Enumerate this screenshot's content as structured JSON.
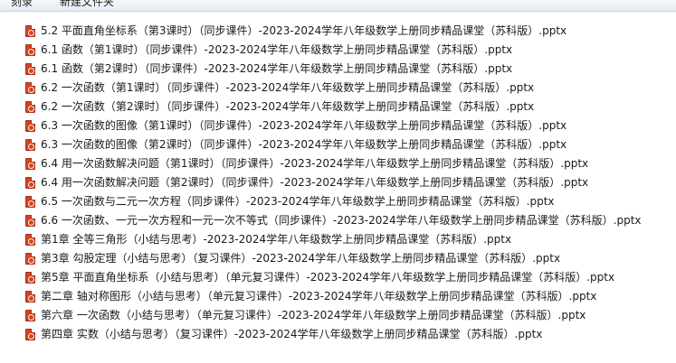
{
  "toolbar": {
    "burn_label": "刻录",
    "new_folder_label": "新建文件夹"
  },
  "files": [
    {
      "name": "5.2 平面直角坐标系（第3课时）（同步课件）-2023-2024学年八年级数学上册同步精品课堂（苏科版）.pptx",
      "icon": "pptx-file-icon"
    },
    {
      "name": "6.1 函数（第1课时）（同步课件）-2023-2024学年八年级数学上册同步精品课堂（苏科版）.pptx",
      "icon": "pptx-file-icon"
    },
    {
      "name": "6.1 函数（第2课时）（同步课件）-2023-2024学年八年级数学上册同步精品课堂（苏科版）.pptx",
      "icon": "pptx-file-icon"
    },
    {
      "name": "6.2 一次函数（第1课时）（同步课件）-2023-2024学年八年级数学上册同步精品课堂（苏科版）.pptx",
      "icon": "pptx-file-icon"
    },
    {
      "name": "6.2 一次函数（第2课时）（同步课件）-2023-2024学年八年级数学上册同步精品课堂（苏科版）.pptx",
      "icon": "pptx-file-icon"
    },
    {
      "name": "6.3 一次函数的图像（第1课时）（同步课件）-2023-2024学年八年级数学上册同步精品课堂（苏科版）.pptx",
      "icon": "pptx-file-icon"
    },
    {
      "name": "6.3 一次函数的图像（第2课时）（同步课件）-2023-2024学年八年级数学上册同步精品课堂（苏科版）.pptx",
      "icon": "pptx-file-icon"
    },
    {
      "name": "6.4 用一次函数解决问题（第1课时）（同步课件）-2023-2024学年八年级数学上册同步精品课堂（苏科版）.pptx",
      "icon": "pptx-file-icon"
    },
    {
      "name": "6.4 用一次函数解决问题（第2课时）（同步课件）-2023-2024学年八年级数学上册同步精品课堂（苏科版）.pptx",
      "icon": "pptx-file-icon"
    },
    {
      "name": "6.5 一次函数与二元一次方程（同步课件）-2023-2024学年八年级数学上册同步精品课堂（苏科版）.pptx",
      "icon": "pptx-file-icon"
    },
    {
      "name": "6.6 一次函数、一元一次方程和一元一次不等式（同步课件）-2023-2024学年八年级数学上册同步精品课堂（苏科版）.pptx",
      "icon": "pptx-file-icon"
    },
    {
      "name": "第1章 全等三角形（小结与思考）-2023-2024学年八年级数学上册同步精品课堂（苏科版）.pptx",
      "icon": "pptx-file-icon"
    },
    {
      "name": "第3章 勾股定理（小结与思考）（复习课件）-2023-2024学年八年级数学上册同步精品课堂（苏科版）.pptx",
      "icon": "pptx-file-icon"
    },
    {
      "name": "第5章 平面直角坐标系（小结与思考）（单元复习课件）-2023-2024学年八年级数学上册同步精品课堂（苏科版）.pptx",
      "icon": "pptx-file-icon"
    },
    {
      "name": "第二章 轴对称图形（小结与思考）（单元复习课件）-2023-2024学年八年级数学上册同步精品课堂（苏科版）.pptx",
      "icon": "pptx-file-icon"
    },
    {
      "name": "第六章 一次函数（小结与思考）（单元复习课件）-2023-2024学年八年级数学上册同步精品课堂（苏科版）.pptx",
      "icon": "pptx-file-icon"
    },
    {
      "name": "第四章 实数（小结与思考）（复习课件）-2023-2024学年八年级数学上册同步精品课堂（苏科版）.pptx",
      "icon": "pptx-file-icon"
    }
  ]
}
